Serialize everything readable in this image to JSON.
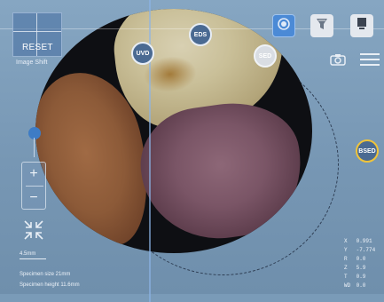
{
  "toolbar": {
    "reset_label": "RESET",
    "image_shift_label": "Image Shift",
    "buttons": [
      {
        "name": "navcam-live-button",
        "icon": "circle-lens-icon",
        "active": true
      },
      {
        "name": "sem-mode-button",
        "icon": "funnel-icon",
        "active": false
      },
      {
        "name": "device-button",
        "icon": "monitor-icon",
        "active": false
      }
    ]
  },
  "detectors": {
    "uvd": "UVD",
    "eds": "EDS",
    "sed": "SED",
    "bsed": "BSED"
  },
  "colors": {
    "background": "#7a9bb8",
    "accent_blue": "#3e7cc5",
    "detector_fill": "#4a6a92",
    "bsed_ring": "#f0c43a"
  },
  "left_controls": {
    "zoom_in": "+",
    "zoom_out": "−"
  },
  "info": {
    "scale": "4.5mm",
    "specimen_size": "Specimen size 21mm",
    "specimen_height": "Specimen height 11.6mm"
  },
  "coordinates": [
    {
      "axis": "X",
      "value": "0.991"
    },
    {
      "axis": "Y",
      "value": "-7.774"
    },
    {
      "axis": "R",
      "value": "0.0"
    },
    {
      "axis": "Z",
      "value": "5.9"
    },
    {
      "axis": "T",
      "value": "0.9"
    },
    {
      "axis": "WD",
      "value": "0.0"
    }
  ]
}
